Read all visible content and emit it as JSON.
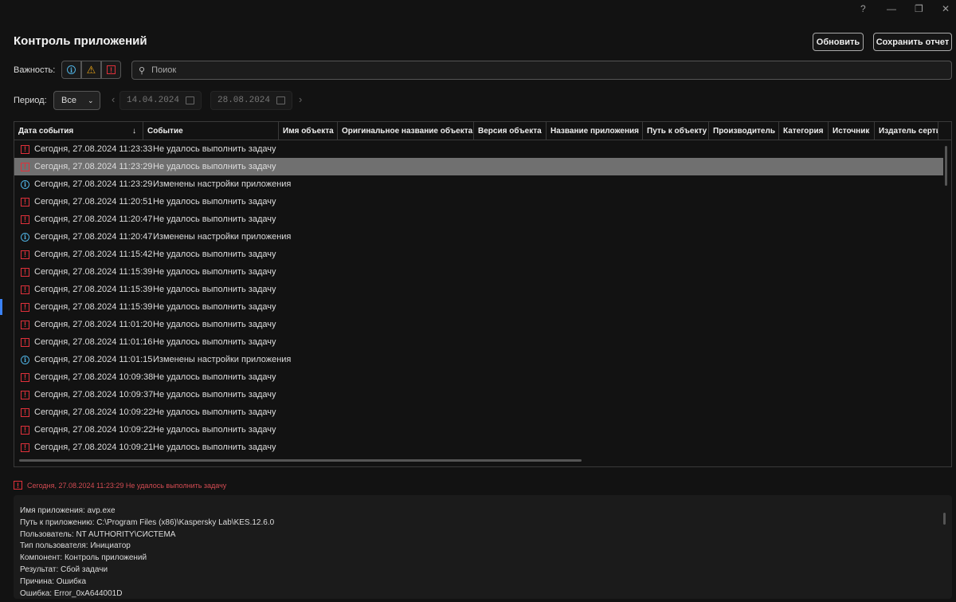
{
  "window": {
    "help": "?",
    "minimize": "—",
    "restore": "❐",
    "close": "✕"
  },
  "header": {
    "title": "Контроль приложений",
    "refresh": "Обновить",
    "save_report": "Сохранить отчет"
  },
  "filters": {
    "severity_label": "Важность:",
    "search_placeholder": "Поиок",
    "period_label": "Период:",
    "period_value": "Все",
    "date_from": "14.04.2024",
    "date_to": "28.08.2024"
  },
  "columns": [
    "Дата события",
    "Событие",
    "Имя объекта",
    "Оригинальное название объекта",
    "Версия объекта",
    "Название приложения",
    "Путь к объекту",
    "Производитель",
    "Категория",
    "Источник",
    "Издатель сертифи"
  ],
  "rows": [
    {
      "type": "err",
      "date": "Сегодня, 27.08.2024 11:23:33",
      "event": "Не удалось выполнить задачу"
    },
    {
      "type": "err",
      "date": "Сегодня, 27.08.2024 11:23:29",
      "event": "Не удалось выполнить задачу",
      "selected": true
    },
    {
      "type": "info",
      "date": "Сегодня, 27.08.2024 11:23:29",
      "event": "Изменены настройки приложения"
    },
    {
      "type": "err",
      "date": "Сегодня, 27.08.2024 11:20:51",
      "event": "Не удалось выполнить задачу"
    },
    {
      "type": "err",
      "date": "Сегодня, 27.08.2024 11:20:47",
      "event": "Не удалось выполнить задачу"
    },
    {
      "type": "info",
      "date": "Сегодня, 27.08.2024 11:20:47",
      "event": "Изменены настройки приложения"
    },
    {
      "type": "err",
      "date": "Сегодня, 27.08.2024 11:15:42",
      "event": "Не удалось выполнить задачу"
    },
    {
      "type": "err",
      "date": "Сегодня, 27.08.2024 11:15:39",
      "event": "Не удалось выполнить задачу"
    },
    {
      "type": "err",
      "date": "Сегодня, 27.08.2024 11:15:39",
      "event": "Не удалось выполнить задачу"
    },
    {
      "type": "err",
      "date": "Сегодня, 27.08.2024 11:15:39",
      "event": "Не удалось выполнить задачу"
    },
    {
      "type": "err",
      "date": "Сегодня, 27.08.2024 11:01:20",
      "event": "Не удалось выполнить задачу"
    },
    {
      "type": "err",
      "date": "Сегодня, 27.08.2024 11:01:16",
      "event": "Не удалось выполнить задачу"
    },
    {
      "type": "info",
      "date": "Сегодня, 27.08.2024 11:01:15",
      "event": "Изменены настройки приложения"
    },
    {
      "type": "err",
      "date": "Сегодня, 27.08.2024 10:09:38",
      "event": "Не удалось выполнить задачу"
    },
    {
      "type": "err",
      "date": "Сегодня, 27.08.2024 10:09:37",
      "event": "Не удалось выполнить задачу"
    },
    {
      "type": "err",
      "date": "Сегодня, 27.08.2024 10:09:22",
      "event": "Не удалось выполнить задачу"
    },
    {
      "type": "err",
      "date": "Сегодня, 27.08.2024 10:09:22",
      "event": "Не удалось выполнить задачу"
    },
    {
      "type": "err",
      "date": "Сегодня, 27.08.2024 10:09:21",
      "event": "Не удалось выполнить задачу"
    }
  ],
  "details": {
    "summary": "Сегодня, 27.08.2024 11:23:29 Не удалось выполнить задачу",
    "lines": [
      "Имя приложения: avp.exe",
      "Путь к приложению: C:\\Program Files (x86)\\Kaspersky Lab\\KES.12.6.0",
      "Пользователь: NT AUTHORITY\\СИСТЕМА",
      "Тип пользователя: Инициатор",
      "Компонент: Контроль приложений",
      "Результат: Сбой задачи",
      "Причина: Ошибка",
      "Ошибка: Error_0xA644001D"
    ]
  },
  "colors": {
    "error": "#e0303a",
    "info": "#4fb0e0",
    "warning": "#e8a317",
    "selected_row": "#707070"
  }
}
